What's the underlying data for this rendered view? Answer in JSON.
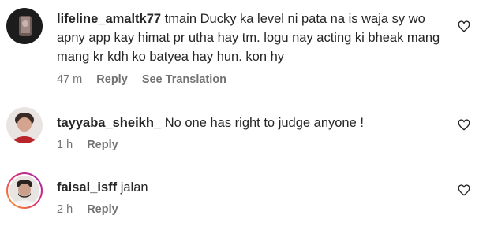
{
  "comments": [
    {
      "username": "lifeline_amaltk77",
      "text": "tmain Ducky ka level ni pata na is waja sy wo apny app kay himat pr utha hay tm. logu nay acting ki bheak mang mang kr kdh ko batyea hay hun. kon hy",
      "time": "47 m",
      "reply_label": "Reply",
      "translate_label": "See Translation"
    },
    {
      "username": "tayyaba_sheikh_",
      "text": "No one has right to judge anyone !",
      "time": "1 h",
      "reply_label": "Reply"
    },
    {
      "username": "faisal_isff",
      "text": "jalan",
      "time": "2 h",
      "reply_label": "Reply"
    }
  ],
  "icons": {
    "like": "heart-outline-icon"
  },
  "colors": {
    "text_primary": "#262626",
    "text_secondary": "#737373",
    "story_ring_start": "#f9a825",
    "story_ring_end": "#9c27b0"
  }
}
